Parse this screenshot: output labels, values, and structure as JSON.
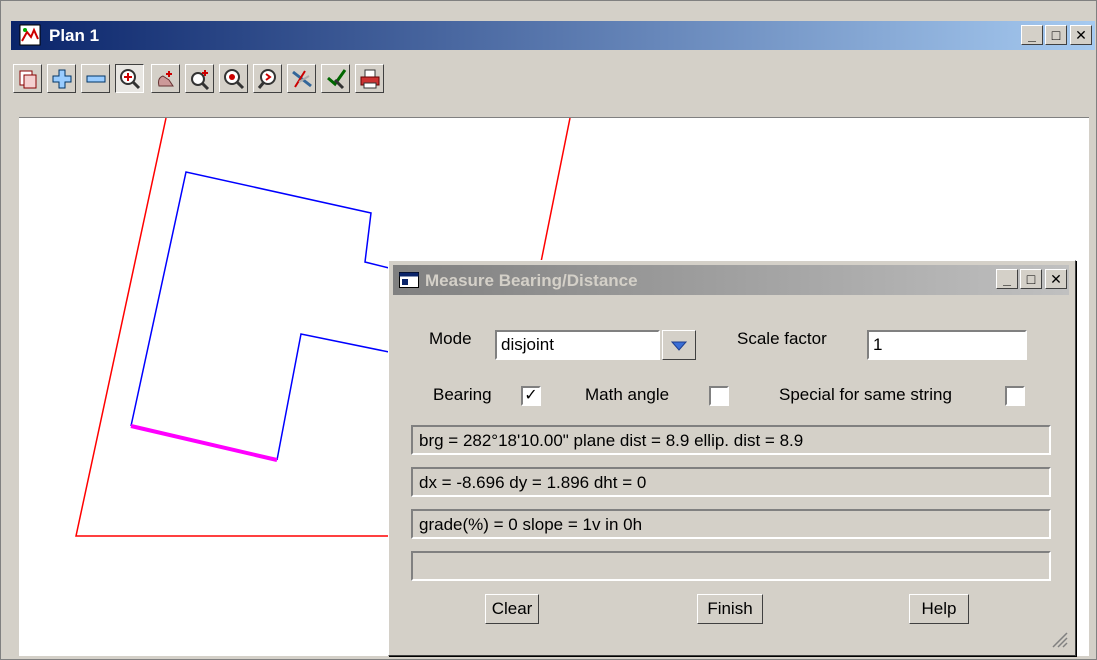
{
  "window": {
    "title": "Plan 1"
  },
  "window_controls": {
    "minimize": "_",
    "maximize": "□",
    "close": "✕"
  },
  "toolbar": {
    "buttons": [
      "plan-views-icon",
      "zoom-in-icon",
      "zoom-out-icon",
      "zoom-extent-icon",
      "pan-icon",
      "zoom-window-icon",
      "zoom-centre-icon",
      "zoom-previous-icon",
      "snap-icon",
      "pick-icon",
      "print-icon"
    ]
  },
  "dialog": {
    "title": "Measure Bearing/Distance",
    "mode_label": "Mode",
    "mode_value": "disjoint",
    "scale_factor_label": "Scale factor",
    "scale_factor_value": "1",
    "bearing_label": "Bearing",
    "bearing_checked": "✓",
    "math_angle_label": "Math angle",
    "special_label": "Special for same string",
    "readout_1": "brg = 282°18'10.00\" plane dist = 8.9  ellip. dist = 8.9",
    "readout_2": "dx = -8.696 dy = 1.896 dht = 0",
    "readout_3": "grade(%) = 0 slope = 1v in 0h",
    "readout_4": "",
    "clear_label": "Clear",
    "finish_label": "Finish",
    "help_label": "Help"
  },
  "colors": {
    "boundary": "#ff0000",
    "building": "#0000ff",
    "measured_segment": "#ff00ff"
  }
}
